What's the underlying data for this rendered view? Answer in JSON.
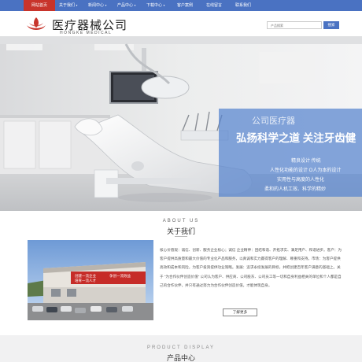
{
  "nav": {
    "items": [
      {
        "label": "网站首页",
        "active": true,
        "has_arrow": false
      },
      {
        "label": "关于我们",
        "active": false,
        "has_arrow": true
      },
      {
        "label": "新闻中心",
        "active": false,
        "has_arrow": true
      },
      {
        "label": "产品中心",
        "active": false,
        "has_arrow": true
      },
      {
        "label": "下载中心",
        "active": false,
        "has_arrow": true
      },
      {
        "label": "客户案例",
        "active": false,
        "has_arrow": false
      },
      {
        "label": "在线留言",
        "active": false,
        "has_arrow": false
      },
      {
        "label": "联系我们",
        "active": false,
        "has_arrow": false
      }
    ]
  },
  "header": {
    "brand_cn": "医疗器械公司",
    "brand_en": "HONGKE MEDICAL",
    "search_placeholder": "产品搜索",
    "search_button": "搜索"
  },
  "banner": {
    "title_small": "公司医疗器",
    "title_big": "弘扬科学之道 关注牙齿健",
    "lines": [
      "精良设计 传统",
      "人性化功能的设计 Ο人为本的设计",
      "实用性与高度的人性化",
      "柔和的人机工效、科学的精妙"
    ],
    "dot_count": 3,
    "active_dot": 0
  },
  "about": {
    "title_en": "ABOUT US",
    "title_cn": "关于我们",
    "body": "核心价值观：诚信、创新、服务企业核心；诚信 企业精神：团结和谐、开拓求实、满足用户、和谐进步。客户：为客户提供高质量和最大价值的专业化产品和服务，以真诚和实力赢得客户的理解、尊重和支持。市场：为客户提供高效和成本和风险，为客户投资提供功业策略。发展：追求永续发展的目标，并把创建百年客户满意的基础上。关于 “为合作伙伴创造价值” 公司认为客户、供应商、公司股东、公司员工等一切和自身利益相关的单位和个人都是自己的合作伙伴，并只有通过努力为合作伙伴创造价值，才能体现自身。",
    "more_button": "了解更多",
    "photo_sign": [
      "创建一流企业",
      "培育一流人才",
      "争创一流效益"
    ]
  },
  "products": {
    "title_en": "PRODUCT DISPLAY",
    "title_cn": "产品中心"
  },
  "colors": {
    "nav_bg": "#4a72c2",
    "nav_active": "#c8342b",
    "accent_blue": "#4a72c2",
    "logo_red": "#c8342b"
  }
}
